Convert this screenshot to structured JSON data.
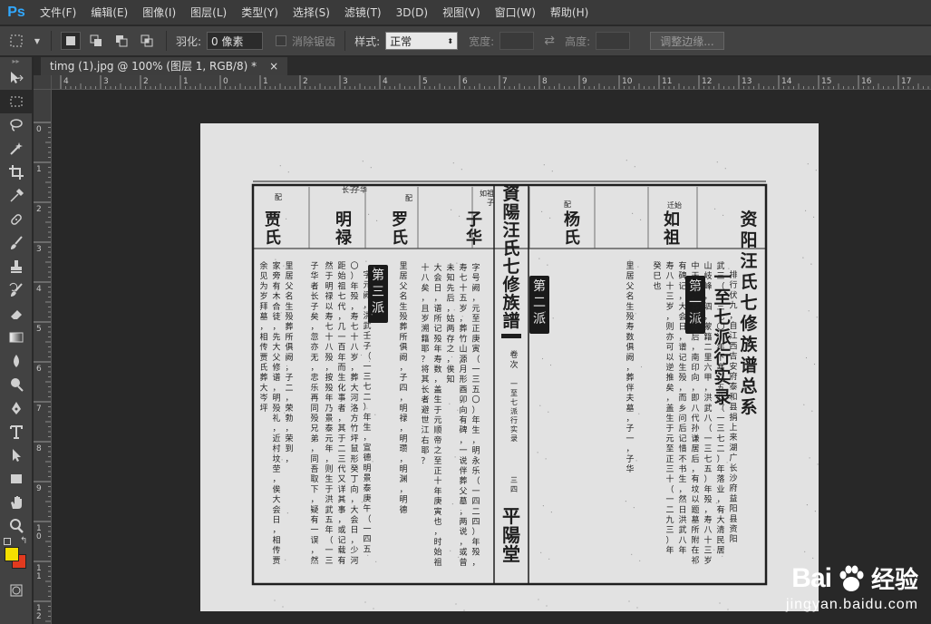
{
  "app": {
    "logo": "Ps"
  },
  "menu": [
    "文件(F)",
    "编辑(E)",
    "图像(I)",
    "图层(L)",
    "类型(Y)",
    "选择(S)",
    "滤镜(T)",
    "3D(D)",
    "视图(V)",
    "窗口(W)",
    "帮助(H)"
  ],
  "options": {
    "feather_label": "羽化:",
    "feather_value": "0 像素",
    "antialias_label": "消除锯齿",
    "style_label": "样式:",
    "style_value": "正常",
    "width_label": "宽度:",
    "height_label": "高度:",
    "refine_button": "调整边缘..."
  },
  "tab": {
    "title": "timg (1).jpg @ 100% (图层 1, RGB/8) *",
    "close": "×"
  },
  "ruler_h_ticks": [
    "4",
    "3",
    "2",
    "1",
    "0",
    "1",
    "2",
    "3",
    "4",
    "5",
    "6",
    "7",
    "8",
    "9",
    "10",
    "11",
    "12",
    "13",
    "14",
    "15",
    "16",
    "17"
  ],
  "ruler_v_ticks": [
    "0",
    "1",
    "2",
    "3",
    "4",
    "5",
    "6",
    "7",
    "8",
    "9",
    "1 0",
    "1 1",
    "1 2"
  ],
  "tools": [
    "move-tool",
    "marquee-tool",
    "lasso-tool",
    "magic-wand-tool",
    "crop-tool",
    "eyedropper-tool",
    "healing-brush-tool",
    "brush-tool",
    "clone-stamp-tool",
    "history-brush-tool",
    "eraser-tool",
    "gradient-tool",
    "blur-tool",
    "dodge-tool",
    "pen-tool",
    "type-tool",
    "path-selection-tool",
    "rectangle-tool",
    "hand-tool",
    "zoom-tool"
  ],
  "colors": {
    "foreground": "#f5e000",
    "background": "#e23a1f",
    "accent_logo": "#31a8ff"
  },
  "document": {
    "title_columns": [
      "资阳汪氏七修族谱总系",
      "一至七派行实录"
    ],
    "names": [
      "如祖",
      "杨氏",
      "子华",
      "罗氏",
      "明禄",
      "贾氏"
    ],
    "badges": [
      "第一派",
      "第二派",
      "第三派"
    ],
    "spine_title": "資陽汪氏七修族譜",
    "spine_sub": "卷次",
    "spine_bottom": "平陽堂",
    "spine_range": "一至七派行实录",
    "spine_page": "三四",
    "small_labels": [
      "迁始",
      "配",
      "如祖",
      "子",
      "配",
      "子华",
      "长子",
      "配"
    ],
    "text_cols": [
      "排行伏九，自江西吉安府泰和县捐上来湖广长沙府益阳县资阳",
      "武三（一三七〇）年下塞，五八（一三七二）年落业，有大清民居",
      "山岐峰，泗，蒙籍二里六甲，洪武八（一三七五）年殁，寿八十三岁，",
      "中天清，葬所居后，南印向，即八代孙谦居后，有坟以题墓所附在祁",
      "有碑记，大会日，谱记生殁，而乡问后记惜不书生，然日洪武八年",
      "寿八十三岁，则亦可以逆推矣，盖生于元至正三十（一二九三）年",
      "癸巳也",
      "里居父名生殁寿数俱阙，葬伴夫墓，子一，子华",
      "字号阙，元至正庚寅（一三五〇）年生，明永乐（一四二四）年殁，",
      "寿七十五岁，葬竹山源月形酉卯向有碑，一说伴葬父墓，两说，或曾迁",
      "未知先后，姑两存之，俟知",
      "大会日，谱所记殁年寿数，盖生于元顺帝之至正十年庚寅也，时始祖年五",
      "十八矣，且岁溯籍耶？将其长者避世江右耶？",
      "里居父名生殁葬所俱阙，子四，明禄，明瓒，明渊，明德",
      "字元阙，洪武壬子（一三七二）年生，宣德明景泰庚午（一四五",
      "〇）年殁，寿七十八岁，葬大河洛方竹坪鼠形癸丁向，大会日，少河",
      "距始祖七代，几一百年而生化事者，其于二三代又详其事，或记载有差也，",
      "然于明禄以寿七十八殁，按殁年乃景泰元年，则生于洪武五年（一三七二）年",
      "子华者长子矣，忽亦无，忠乐再同殁兄弟，同吾取下，疑有一误，然待记",
      "里居父名生殁葬所俱阙，子二，荣勃，荣到，",
      "家旁有木合徒，先大父修谱，明殁礼，近村坟茔，俟大会日，相传贾氏葬大岑坪",
      "余见为岁拜墓，相传贾氏葬大岑坪"
    ]
  },
  "watermark": {
    "brand": "Bai",
    "brand2": "经验",
    "url": "jingyan.baidu.com"
  }
}
